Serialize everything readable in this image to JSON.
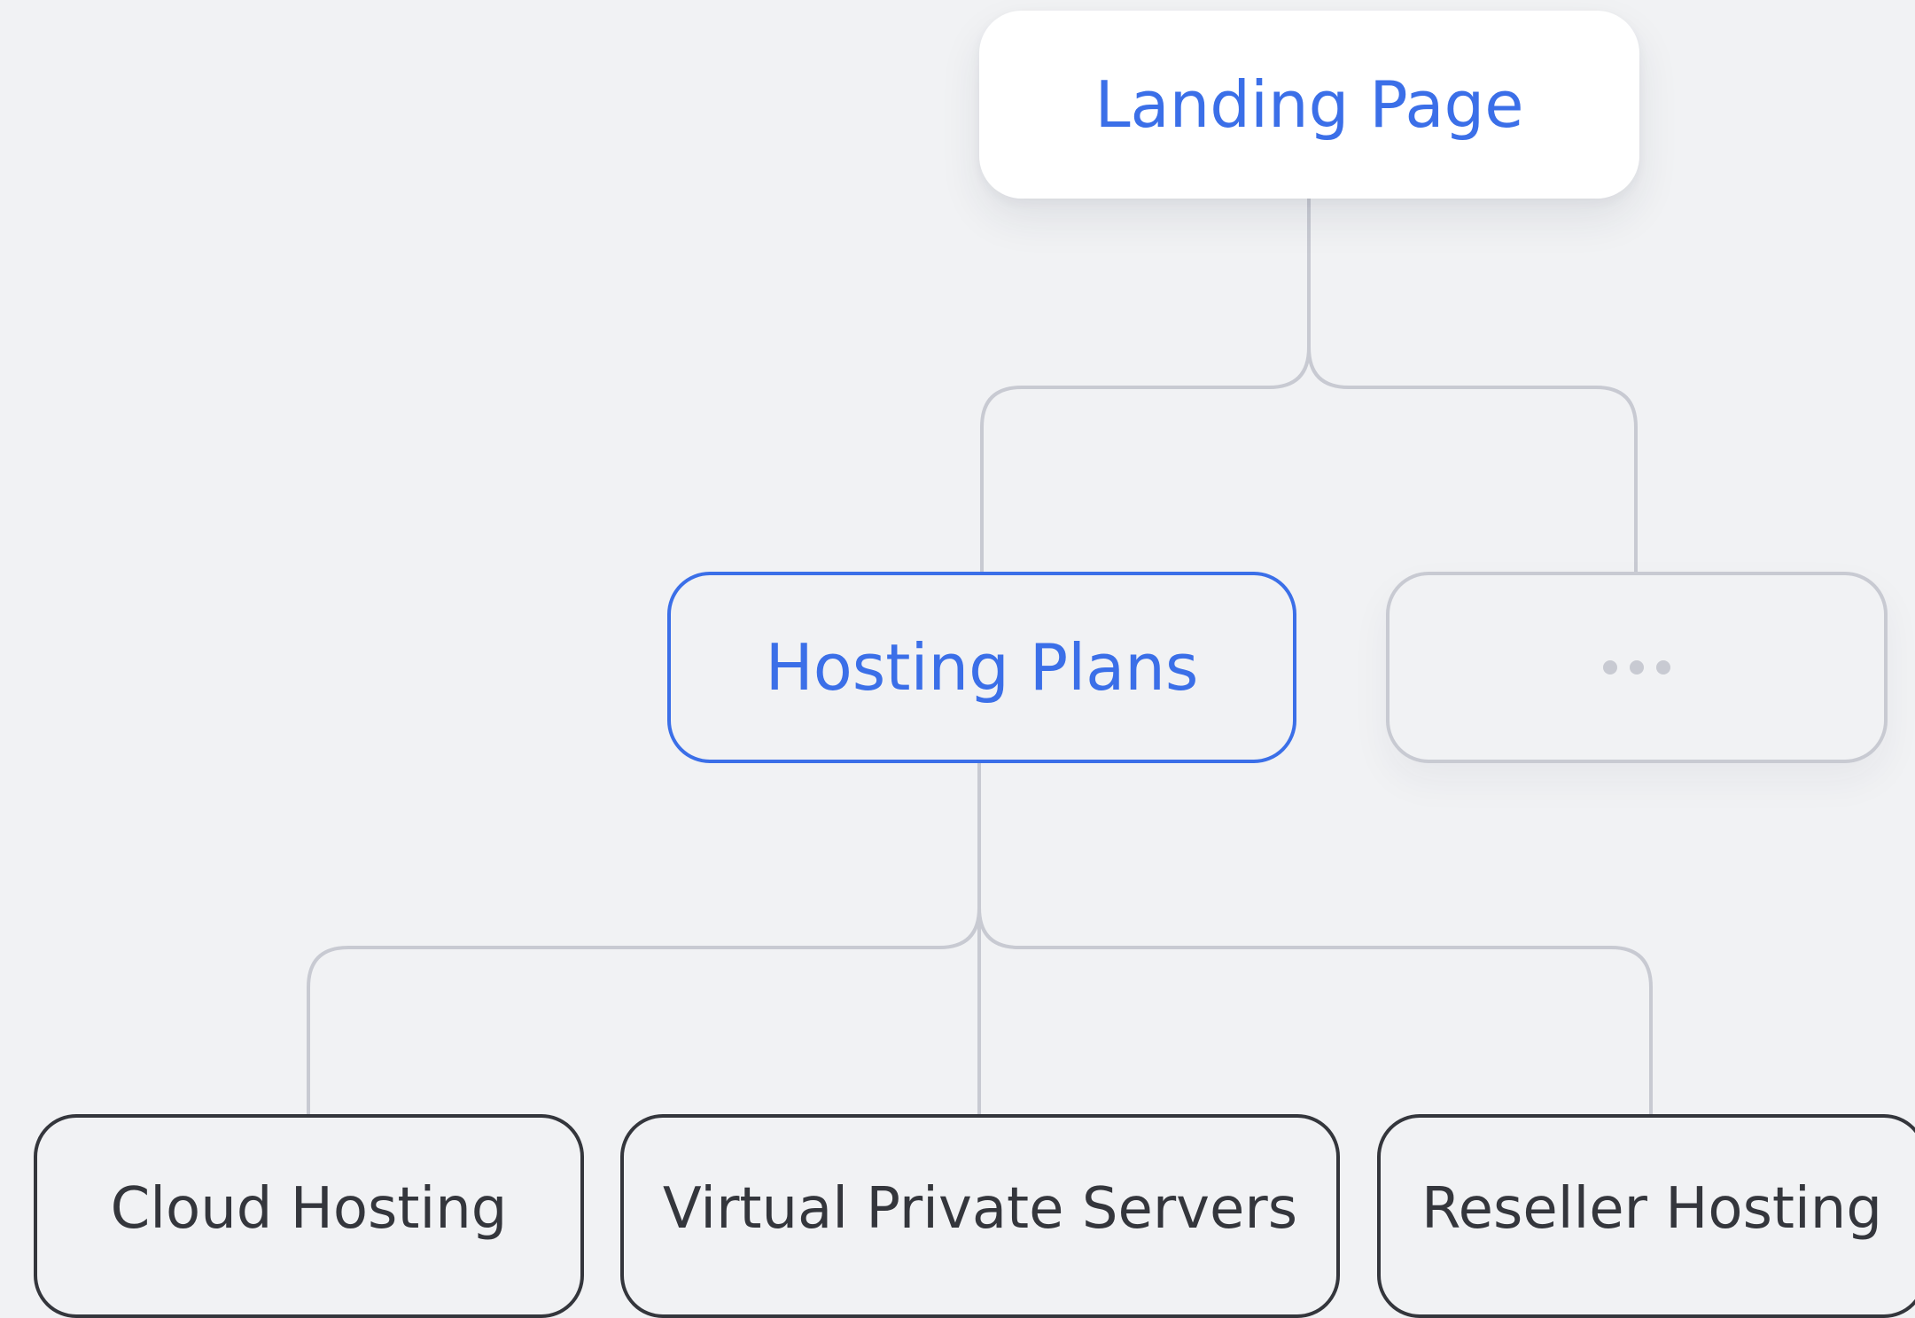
{
  "diagram": {
    "root": {
      "label": "Landing Page"
    },
    "level2": [
      {
        "label": "Hosting Plans",
        "selected": true
      },
      {
        "label": "",
        "icon": "ellipsis-icon",
        "placeholder": true
      }
    ],
    "level3": [
      {
        "label": "Cloud Hosting"
      },
      {
        "label": "Virtual Private Servers"
      },
      {
        "label": "Reseller Hosting"
      }
    ]
  },
  "colors": {
    "background": "#f1f2f4",
    "accent": "#3b6fe8",
    "connector": "#c8cad2",
    "leaf_text": "#34363c",
    "root_fill": "#ffffff"
  }
}
